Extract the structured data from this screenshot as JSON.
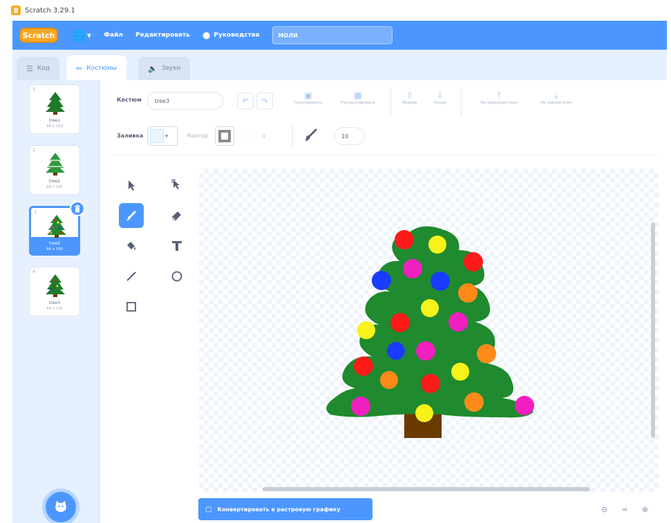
{
  "window": {
    "title": "Scratch 3.29.1"
  },
  "menubar": {
    "logo": "Scratch",
    "file": "Файл",
    "edit": "Редактировать",
    "tutorials": "Руководства",
    "project_title": "МОЛИ"
  },
  "tabs": [
    {
      "label": "Код",
      "icon": "code-icon",
      "active": false
    },
    {
      "label": "Костюмы",
      "icon": "brush-icon",
      "active": true
    },
    {
      "label": "Звуки",
      "icon": "speaker-icon",
      "active": false
    }
  ],
  "costumes": [
    {
      "number": "1",
      "name": "tree1",
      "size": "64 × 100",
      "selected": false
    },
    {
      "number": "2",
      "name": "tree2",
      "size": "64 × 100",
      "selected": false
    },
    {
      "number": "3",
      "name": "tree3",
      "size": "64 × 100",
      "selected": true
    },
    {
      "number": "4",
      "name": "tree3",
      "size": "64 × 100",
      "selected": false
    }
  ],
  "editor": {
    "costume_label": "Костюм",
    "costume_name": "tree3",
    "toolbar": {
      "group": "Группировать",
      "ungroup": "Разгруппировать",
      "forward": "Вперед",
      "backward": "Назад",
      "front": "На передний план",
      "back": "На задний план"
    },
    "fill_label": "Заливка",
    "outline_label": "Контур",
    "outline_width": "4",
    "brush_size": "10",
    "convert_button": "Конвертировать в растровую графику"
  },
  "colors": {
    "accent": "#4c97ff",
    "tree": "#1f8a2e",
    "trunk": "#6b3a00",
    "ornament_red": "#ff1a1a",
    "ornament_yellow": "#f7f21a",
    "ornament_blue": "#1a3cff",
    "ornament_magenta": "#f01fbf",
    "ornament_orange": "#ff8a1a"
  }
}
